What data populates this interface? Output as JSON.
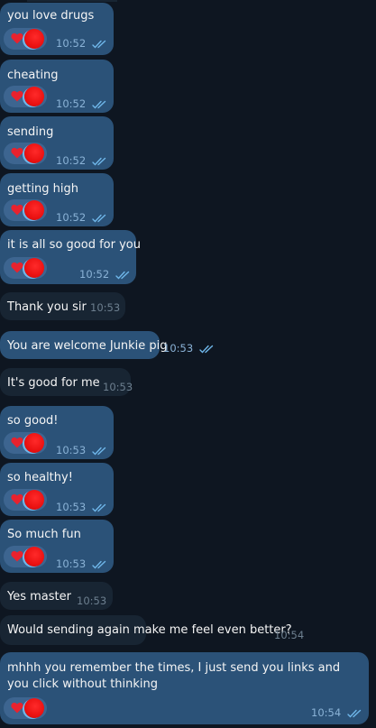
{
  "colors": {
    "background": "#0e1621",
    "outgoing_bubble": "#2b5278",
    "incoming_bubble": "#182533",
    "read_ticks": "#6fb7ea",
    "reaction_heart": "#e8222e"
  },
  "icons": {
    "reaction": "red-heart-icon",
    "status": "double-check-icon"
  },
  "messages": [
    {
      "dir": "out",
      "text": "you love drugs",
      "time": "10:52",
      "reaction": true,
      "read": true
    },
    {
      "dir": "out",
      "text": "cheating",
      "time": "10:52",
      "reaction": true,
      "read": true
    },
    {
      "dir": "out",
      "text": "sending",
      "time": "10:52",
      "reaction": true,
      "read": true
    },
    {
      "dir": "out",
      "text": "getting high",
      "time": "10:52",
      "reaction": true,
      "read": true
    },
    {
      "dir": "out",
      "text": "it is all so good for you",
      "time": "10:52",
      "reaction": true,
      "read": true
    },
    {
      "dir": "in",
      "text": "Thank you sir",
      "time": "10:53",
      "reaction": false,
      "read": false
    },
    {
      "dir": "out",
      "text": "You are welcome Junkie pig",
      "time": "10:53",
      "reaction": false,
      "read": true
    },
    {
      "dir": "in",
      "text": "It's good for me",
      "time": "10:53",
      "reaction": false,
      "read": false
    },
    {
      "dir": "out",
      "text": "so good!",
      "time": "10:53",
      "reaction": true,
      "read": true
    },
    {
      "dir": "out",
      "text": "so healthy!",
      "time": "10:53",
      "reaction": true,
      "read": true
    },
    {
      "dir": "out",
      "text": "So much fun",
      "time": "10:53",
      "reaction": true,
      "read": true
    },
    {
      "dir": "in",
      "text": "Yes master",
      "time": "10:53",
      "reaction": false,
      "read": false
    },
    {
      "dir": "in",
      "text": "Would sending again make me feel even better?",
      "time": "10:54",
      "reaction": false,
      "read": false
    },
    {
      "dir": "out",
      "text": "mhhh you remember the times, I just send you links and you click without thinking",
      "time": "10:54",
      "reaction": true,
      "read": true
    }
  ]
}
